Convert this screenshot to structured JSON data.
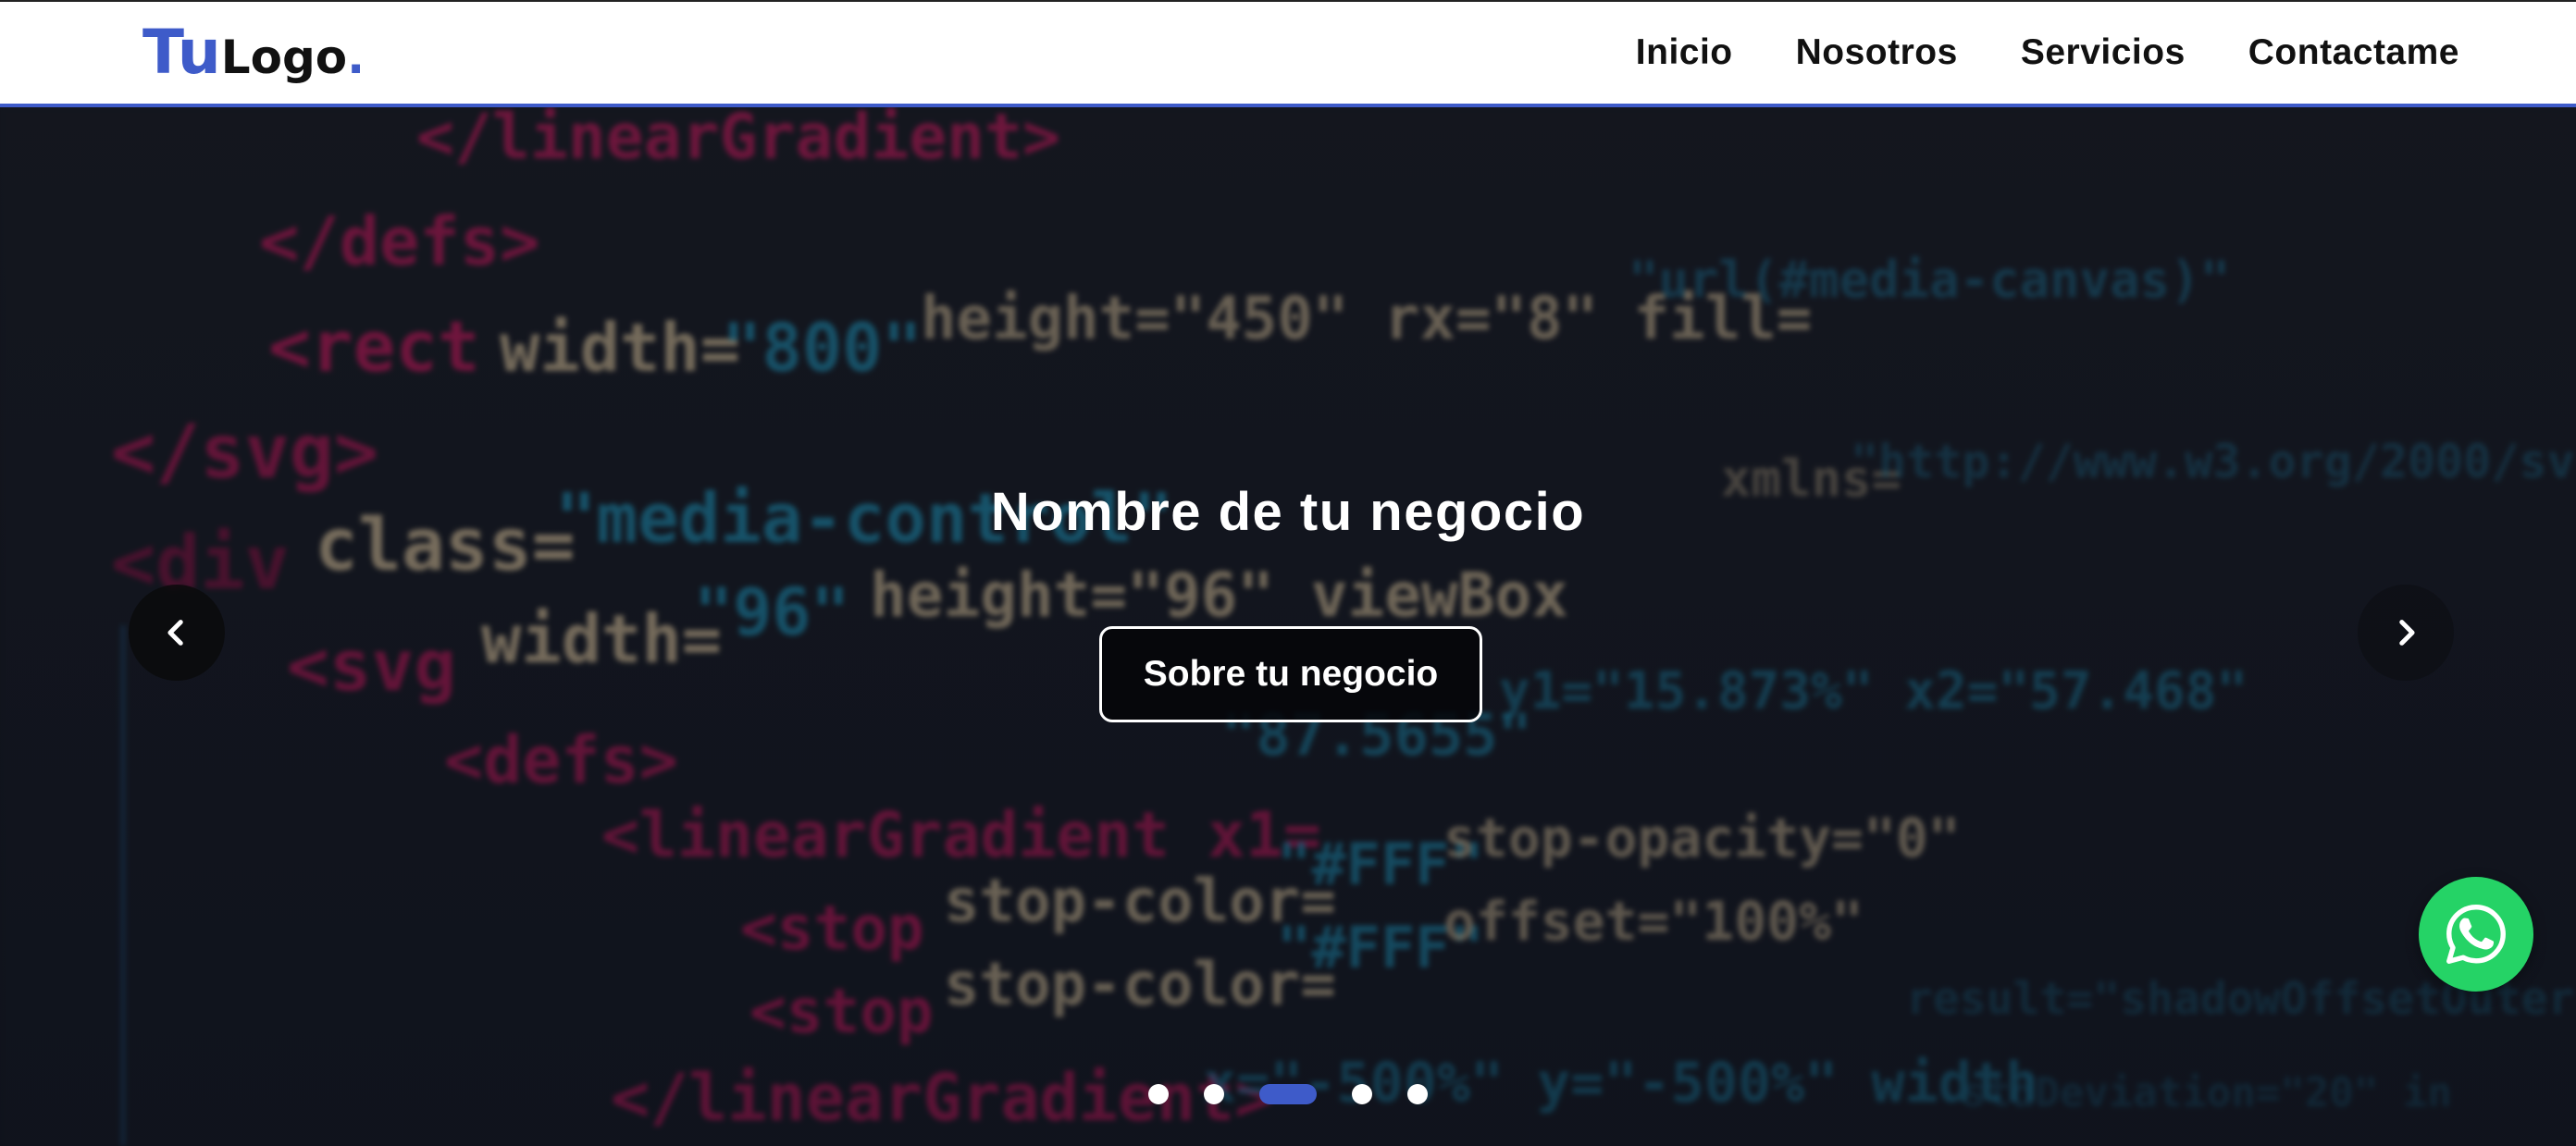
{
  "brand": {
    "logo_part1": "Tu",
    "logo_part2": "Logo",
    "logo_dot": ".",
    "accent_color": "#3e5bc9"
  },
  "nav": {
    "items": [
      {
        "label": "Inicio"
      },
      {
        "label": "Nosotros"
      },
      {
        "label": "Servicios"
      },
      {
        "label": "Contactame"
      }
    ]
  },
  "hero": {
    "title": "Nombre de tu negocio",
    "button_label": "Sobre tu negocio",
    "prev_icon": "chevron-left-icon",
    "next_icon": "chevron-right-icon",
    "slides_count": 5,
    "active_slide": 3,
    "background": "blurred-code-editor-image"
  },
  "whatsapp": {
    "icon": "whatsapp-icon",
    "color": "#25d366"
  }
}
